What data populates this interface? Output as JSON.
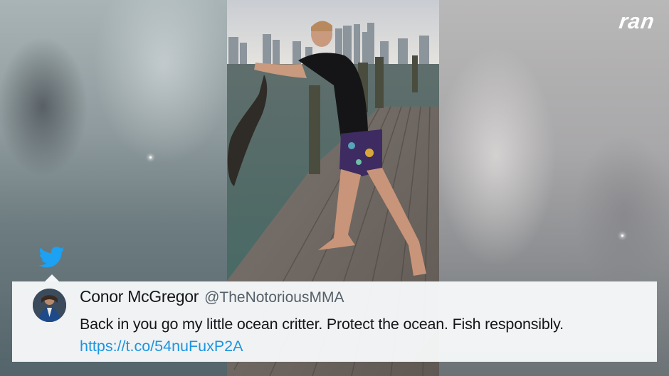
{
  "branding": {
    "logo_text": "ran"
  },
  "tweet": {
    "author_name": "Conor McGregor",
    "handle": "@TheNotoriousMMA",
    "text": "Back in you go my little ocean critter. Protect the ocean. Fish responsibly.",
    "link": "https://t.co/54nuFuxP2A",
    "icon": "twitter-bird-icon"
  },
  "colors": {
    "link": "#1b95e0",
    "twitter_blue": "#1da1f2",
    "card_background": "#f5f7f8"
  }
}
